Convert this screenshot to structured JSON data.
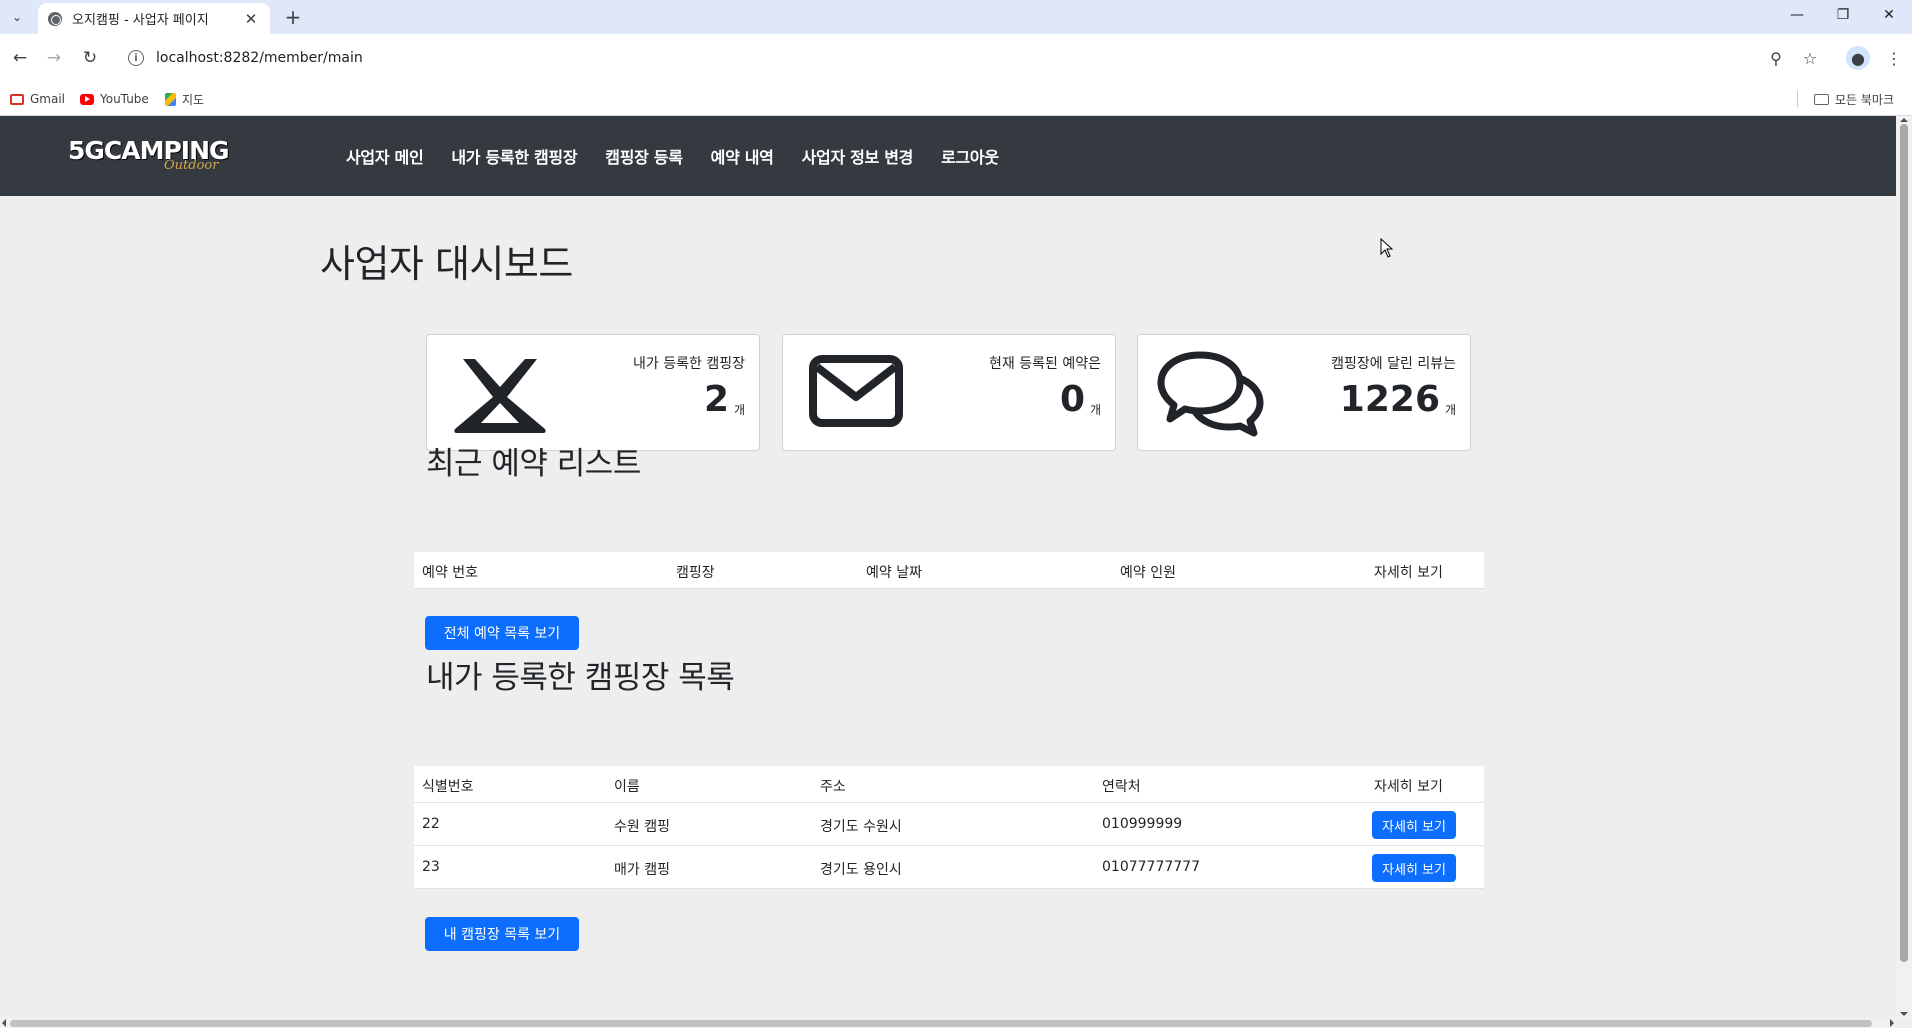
{
  "browser": {
    "tab_title": "오지캠핑 - 사업자 페이지",
    "url": "localhost:8282/member/main",
    "bookmarks": [
      {
        "label": "Gmail",
        "icon": "gmail-icon"
      },
      {
        "label": "YouTube",
        "icon": "youtube-icon"
      },
      {
        "label": "지도",
        "icon": "maps-icon"
      }
    ],
    "all_bookmarks_label": "모든 북마크"
  },
  "navbar": {
    "logo_text": "5GCAMPING",
    "logo_sub": "Outdoor",
    "links": [
      "사업자 메인",
      "내가 등록한 캠핑장",
      "캠핑장 등록",
      "예약 내역",
      "사업자 정보 변경",
      "로그아웃"
    ]
  },
  "dashboard": {
    "title": "사업자 대시보드",
    "cards": [
      {
        "icon": "tent-icon",
        "label": "내가 등록한 캠핑장",
        "value": "2",
        "unit": "개"
      },
      {
        "icon": "envelope-icon",
        "label": "현재 등록된 예약은",
        "value": "0",
        "unit": "개"
      },
      {
        "icon": "comments-icon",
        "label": "캠핑장에 달린 리뷰는",
        "value": "1226",
        "unit": "개"
      }
    ]
  },
  "reservations": {
    "title": "최근 예약 리스트",
    "columns": [
      "예약 번호",
      "캠핑장",
      "예약 날짜",
      "예약 인원",
      "자세히 보기"
    ],
    "rows": [],
    "all_button": "전체 예약 목록 보기"
  },
  "campings": {
    "title": "내가 등록한 캠핑장 목록",
    "columns": [
      "식별번호",
      "이름",
      "주소",
      "연락처",
      "자세히 보기"
    ],
    "rows": [
      {
        "id": "22",
        "name": "수원 캠핑",
        "address": "경기도 수원시",
        "phone": "010999999",
        "detail": "자세히 보기"
      },
      {
        "id": "23",
        "name": "매가 캠핑",
        "address": "경기도 용인시",
        "phone": "01077777777",
        "detail": "자세히 보기"
      }
    ],
    "all_button": "내 캠핑장 목록 보기"
  },
  "colors": {
    "navbar_bg": "#343a40",
    "primary": "#0d6efd",
    "page_bg": "#eeeeee"
  }
}
